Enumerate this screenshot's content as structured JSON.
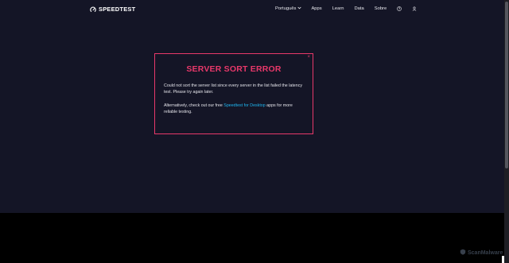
{
  "header": {
    "brand": "SPEEDTEST",
    "nav": {
      "language": "Português",
      "apps": "Apps",
      "learn": "Learn",
      "data": "Data",
      "about": "Sobre"
    },
    "icons": [
      "speedometer-logo-icon",
      "chevron-down-icon",
      "help-icon",
      "user-icon"
    ]
  },
  "modal": {
    "close": "×",
    "title": "SERVER SORT ERROR",
    "paragraph1": "Could not sort the server list since every server in the list failed the latency test. Please try again later.",
    "paragraph2_before": "Alternatively, check out our free ",
    "paragraph2_link": "Speedtest for Desktop",
    "paragraph2_after": " apps for more reliable testing."
  },
  "watermark": {
    "text": "ScanMalware"
  },
  "colors": {
    "background": "#141526",
    "accent": "#e8386a",
    "link": "#1fb6f0"
  }
}
